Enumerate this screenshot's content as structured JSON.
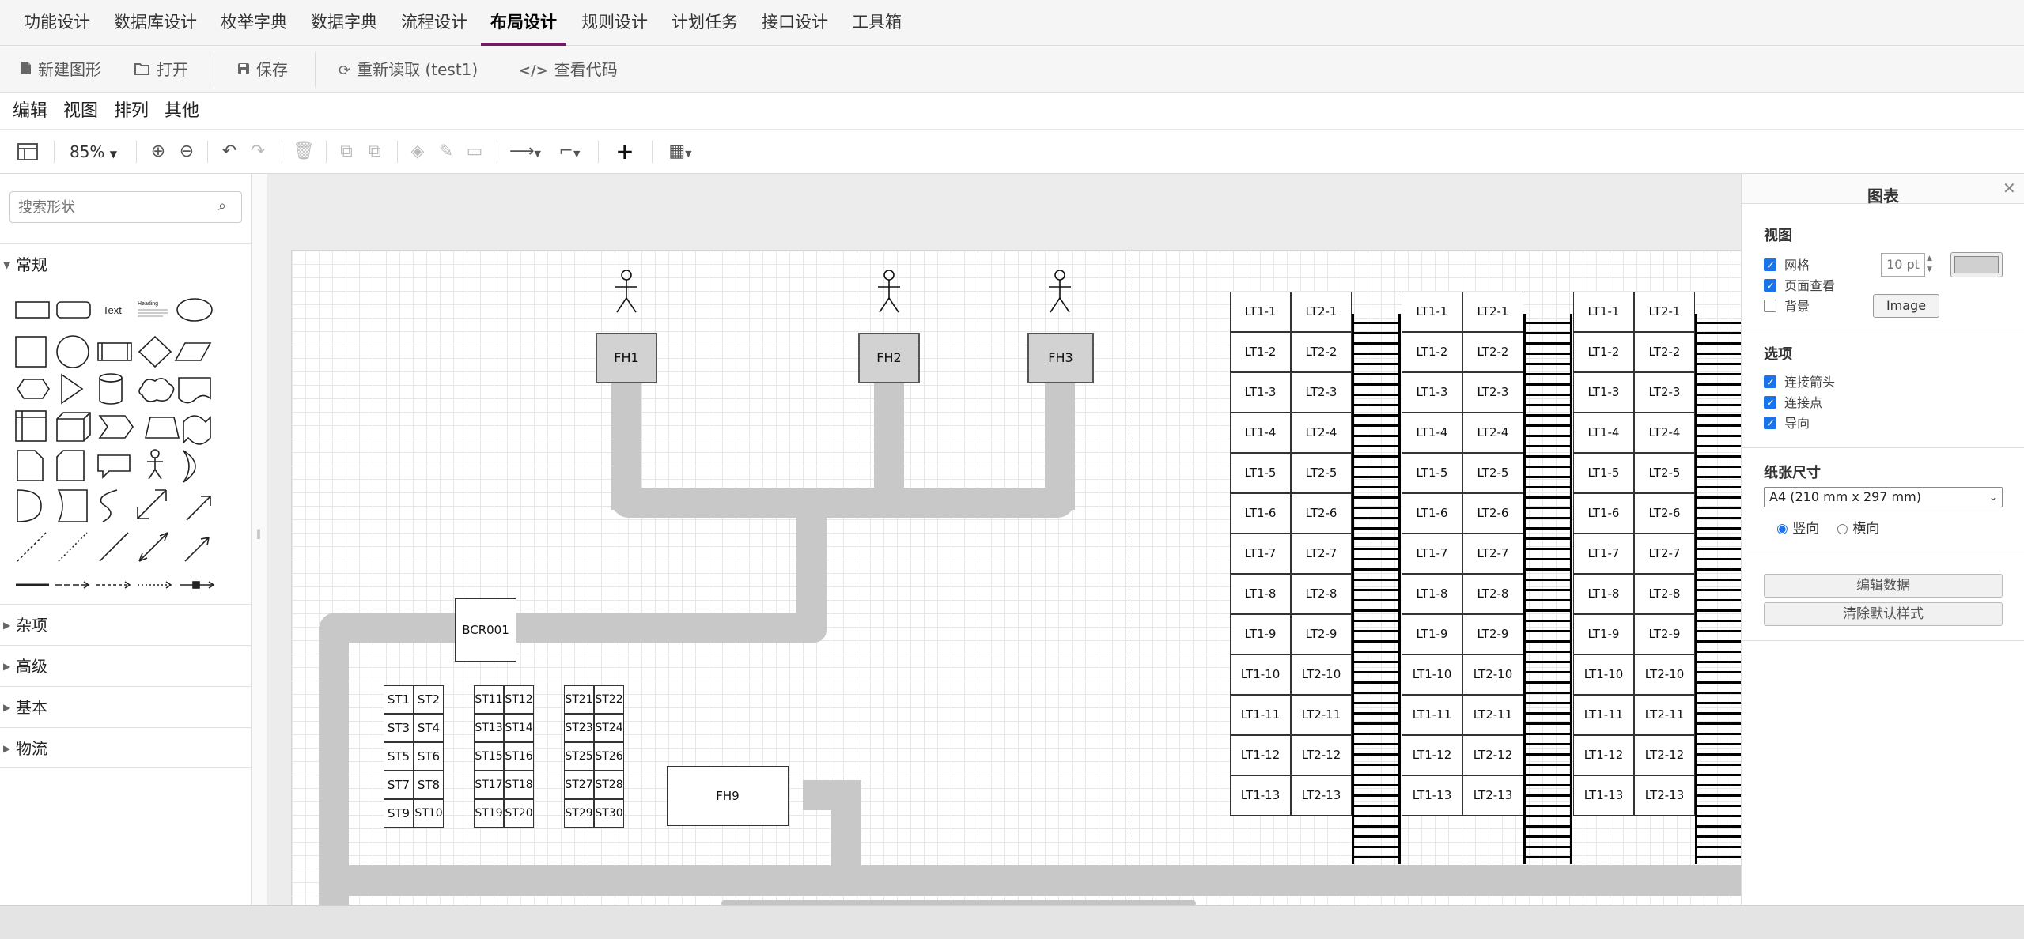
{
  "topnav": {
    "tabs": [
      {
        "label": "功能设计",
        "active": false
      },
      {
        "label": "数据库设计",
        "active": false
      },
      {
        "label": "枚举字典",
        "active": false
      },
      {
        "label": "数据字典",
        "active": false
      },
      {
        "label": "流程设计",
        "active": false
      },
      {
        "label": "布局设计",
        "active": true
      },
      {
        "label": "规则设计",
        "active": false
      },
      {
        "label": "计划任务",
        "active": false
      },
      {
        "label": "接口设计",
        "active": false
      },
      {
        "label": "工具箱",
        "active": false
      }
    ],
    "accent_color": "#6f1d63"
  },
  "toolbar": {
    "new_label": "新建图形",
    "open_label": "打开",
    "save_label": "保存",
    "reload_label": "重新读取 (test1)",
    "code_label": "查看代码"
  },
  "menubar": {
    "items": [
      "编辑",
      "视图",
      "排列",
      "其他"
    ]
  },
  "toolbar2": {
    "zoom": "85%"
  },
  "sidebar": {
    "search_placeholder": "搜索形状",
    "sections": [
      {
        "label": "常规",
        "expanded": true
      },
      {
        "label": "杂项",
        "expanded": false
      },
      {
        "label": "高级",
        "expanded": false
      },
      {
        "label": "基本",
        "expanded": false
      },
      {
        "label": "物流",
        "expanded": false
      }
    ],
    "shape_text_label": "Text",
    "shape_heading_label": "Heading"
  },
  "canvas": {
    "stations": [
      "FH1",
      "FH2",
      "FH3"
    ],
    "bcr_label": "BCR001",
    "fh9_label": "FH9",
    "st_groups": [
      [
        "ST1",
        "ST2",
        "ST3",
        "ST4",
        "ST5",
        "ST6",
        "ST7",
        "ST8",
        "ST9",
        "ST10"
      ],
      [
        "ST11",
        "ST12",
        "ST13",
        "ST14",
        "ST15",
        "ST16",
        "ST17",
        "ST18",
        "ST19",
        "ST20"
      ],
      [
        "ST21",
        "ST22",
        "ST23",
        "ST24",
        "ST25",
        "ST26",
        "ST27",
        "ST28",
        "ST29",
        "ST30"
      ]
    ],
    "lt_col1": [
      "LT1-1",
      "LT1-2",
      "LT1-3",
      "LT1-4",
      "LT1-5",
      "LT1-6",
      "LT1-7",
      "LT1-8",
      "LT1-9",
      "LT1-10",
      "LT1-11",
      "LT1-12",
      "LT1-13"
    ],
    "lt_col2": [
      "LT2-1",
      "LT2-2",
      "LT2-3",
      "LT2-4",
      "LT2-5",
      "LT2-6",
      "LT2-7",
      "LT2-8",
      "LT2-9",
      "LT2-10",
      "LT2-11",
      "LT2-12",
      "LT2-13"
    ],
    "lt_blocks": 3
  },
  "panel": {
    "title": "图表",
    "view_heading": "视图",
    "grid_label": "网格",
    "grid_checked": true,
    "page_view_label": "页面查看",
    "page_view_checked": true,
    "background_label": "背景",
    "background_checked": false,
    "grid_size": "10 pt",
    "image_button": "Image",
    "options_heading": "选项",
    "connection_arrows_label": "连接箭头",
    "connection_arrows_checked": true,
    "connection_points_label": "连接点",
    "connection_points_checked": true,
    "guides_label": "导向",
    "guides_checked": true,
    "paper_heading": "纸张尺寸",
    "paper_size": "A4 (210 mm x 297 mm)",
    "portrait_label": "竖向",
    "landscape_label": "横向",
    "orientation": "portrait",
    "edit_data_button": "编辑数据",
    "clear_style_button": "清除默认样式"
  }
}
